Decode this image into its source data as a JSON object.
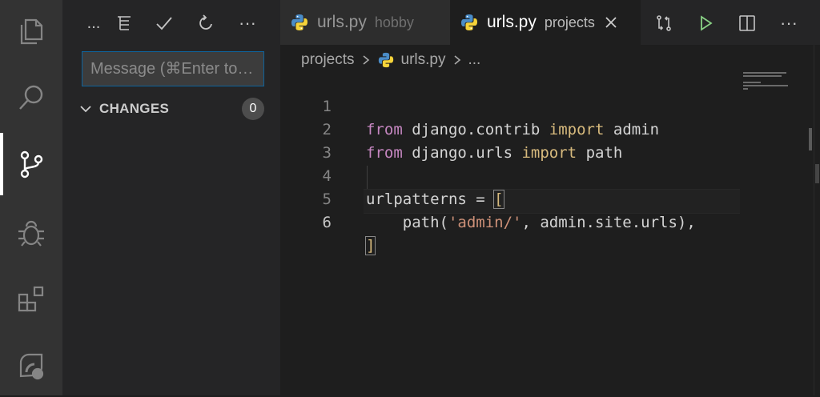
{
  "sidebar": {
    "toolbar": {
      "more_left": "...",
      "commit_icon": "check-icon",
      "refresh_icon": "refresh-icon",
      "more_right": "···"
    },
    "message_placeholder": "Message (⌘Enter to commit)",
    "changes": {
      "label": "CHANGES",
      "count": "0"
    }
  },
  "tabs": [
    {
      "name": "urls.py",
      "description": "hobby",
      "active": false
    },
    {
      "name": "urls.py",
      "description": "projects",
      "active": true
    }
  ],
  "breadcrumb": {
    "folder": "projects",
    "file": "urls.py",
    "more": "..."
  },
  "code": {
    "line_numbers": [
      "1",
      "2",
      "3",
      "4",
      "5",
      "6"
    ],
    "l1": {
      "kw1": "from",
      "mod": " django.contrib ",
      "kw2": "import",
      "name": " admin"
    },
    "l2": {
      "kw1": "from",
      "mod": " django.urls ",
      "kw2": "import",
      "name": " path"
    },
    "l4": {
      "var": "urlpatterns = ",
      "open": "["
    },
    "l5": {
      "pre": "    path(",
      "str": "'admin/'",
      "post": ", admin.site.urls),"
    },
    "l6": {
      "close": "]"
    }
  },
  "colors": {
    "accent": "#0e639c",
    "keyword": "#c586c0",
    "string": "#ce9178",
    "editor_bg": "#1e1e1e"
  }
}
